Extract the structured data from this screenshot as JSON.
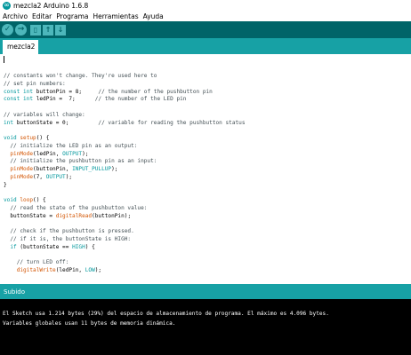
{
  "window": {
    "title": "mezcla2 Arduino 1.6.8"
  },
  "menu": {
    "items": [
      "Archivo",
      "Editar",
      "Programa",
      "Herramientas",
      "Ayuda"
    ]
  },
  "toolbar": {
    "buttons": [
      "verify-icon",
      "upload-icon",
      "new-icon",
      "open-icon",
      "save-icon"
    ]
  },
  "tabs": {
    "active": "mezcla2"
  },
  "editor": {
    "lines": [
      "// constants won't change. They're used here to",
      "// set pin numbers:",
      "const int buttonPin = 8;     // the number of the pushbutton pin",
      "const int ledPin =  7;      // the number of the LED pin",
      "",
      "// variables will change:",
      "int buttonState = 0;         // variable for reading the pushbutton status",
      "",
      "void setup() {",
      "  // initialize the LED pin as an output:",
      "  pinMode(ledPin, OUTPUT);",
      "  // initialize the pushbutton pin as an input:",
      "  pinMode(buttonPin, INPUT_PULLUP);",
      "  pinMode(7, OUTPUT);",
      "}",
      "",
      "void loop() {",
      "  // read the state of the pushbutton value:",
      "  buttonState = digitalRead(buttonPin);",
      "",
      "  // check if the pushbutton is pressed.",
      "  // if it is, the buttonState is HIGH:",
      "  if (buttonState == HIGH) {",
      "",
      "    // turn LED off:",
      "    digitalWrite(ledPin, LOW);"
    ]
  },
  "status": {
    "text": "Subido"
  },
  "console": {
    "lines": [
      "El Sketch usa 1.214 bytes (29%) del espacio de almacenamiento de programa. El máximo es 4.096 bytes.",
      "Variables globales usan 11 bytes de memoria dinámica."
    ]
  },
  "colors": {
    "toolbar": "#006468",
    "tabbar": "#17a1a5",
    "keyword": "#00979c",
    "function": "#d35400",
    "comment": "#434f54",
    "console_bg": "#000000"
  }
}
